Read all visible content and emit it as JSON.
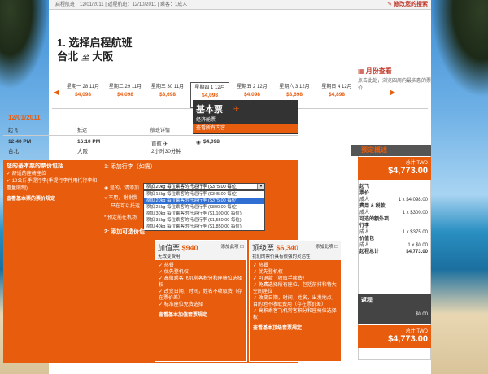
{
  "top_bar": {
    "summary": "启程航班：12/01/2011 | 返程航班：12/10/2011 | 乘客：1成人",
    "modify_link": "✎ 修改您的搜索"
  },
  "step": {
    "title": "1. 选择启程航班",
    "origin": "台北",
    "to": "至",
    "destination": "大阪"
  },
  "month_view": {
    "title": "月份查看",
    "desc": "点击此处，浏览四周内最实惠的票价"
  },
  "dates": [
    {
      "label": "星期一 28 11月",
      "price": "$4,098"
    },
    {
      "label": "星期二 29 11月",
      "price": "$4,098"
    },
    {
      "label": "星期三 30 11月",
      "price": "$3,698"
    },
    {
      "label": "星期四 1 12月",
      "price": "$4,098"
    },
    {
      "label": "星期五 2 12月",
      "price": "$4,098"
    },
    {
      "label": "星期六 3 12月",
      "price": "$3,698"
    },
    {
      "label": "星期日 4 12月",
      "price": "$4,898"
    }
  ],
  "fare_header": {
    "title": "基本票",
    "subtitle": "经济舱票",
    "sub_bar": "查看所有内容"
  },
  "table": {
    "date": "12/01/2011",
    "columns": [
      "起飞",
      "抵达",
      "航班详情"
    ],
    "flight": {
      "dep_time": "12:40 PM",
      "dep_city": "台北",
      "arr_time": "16:10 PM",
      "arr_city": "大阪",
      "details": "直航 ✈",
      "duration": "2小时30分钟",
      "price": "$4,098"
    }
  },
  "basic_includes": {
    "title": "您的基本票的票价包括",
    "items": [
      "舒适的座椅座位",
      "10公斤手提行李(手提行李件用托行李和重量限制)"
    ],
    "link": "查看基本票的票价规定"
  },
  "baggage": {
    "title": "1: 添加行李（如需）",
    "yes_label": "是的，请添加",
    "no_label": "不用，谢谢我",
    "no_sub": "只在可以托运",
    "note": "* 预定前在机场",
    "selected": "添加 20kg 每位乘客的托运行李 ($375.00 每位)",
    "options": [
      "添加 15kg 每位乘客的托运行李 ($345.00 每位)",
      "添加 20kg 每位乘客的托运行李 ($375.00 每位)",
      "添加 25kg 每位乘客的托运行李 ($800.00 每位)",
      "添加 30kg 每位乘客的托运行李 ($1,100.00 每位)",
      "添加 35kg 每位乘客的托运行李 ($1,550.00 每位)",
      "添加 40kg 每位乘客的托运行李 ($1,850.00 每位)"
    ]
  },
  "section2": "2: 添加可选价包",
  "package_value": {
    "name": "加值票",
    "price": "$940",
    "sub": "无改变费用",
    "add": "添加此项",
    "items": [
      "热餐",
      "优先登机权",
      "高敬乘客飞机常客积分和座椅位选择权",
      "改变日期，时间，姓名不收取费（存在票价差）",
      "标准座位免费选择"
    ],
    "link": "查看基本加值套票规定"
  },
  "package_top": {
    "name": "顶级票",
    "price": "$6,340",
    "sub": "我们的票价具有很强的灵活性",
    "add": "添加此项",
    "items": [
      "热餐",
      "优先登机权",
      "可退款（收取手续费）",
      "免费选择所有座位，包括前排和特大空间座位",
      "改变日期，时间，姓名，出发地点，目的地不收取费用（存在票价差）",
      "高积乘客飞机常客积分和座椅位选择权"
    ],
    "link": "查看基本顶级套票规定"
  },
  "summary": {
    "title": "预定概述",
    "total_label": "总计 TWD",
    "total": "$4,773.00",
    "dep_title": "起飞",
    "rows": [
      {
        "label": "票价",
        "value": ""
      },
      {
        "label": "成人",
        "value": "1 x $4,098.00"
      },
      {
        "label": "费用 & 税款",
        "value": ""
      },
      {
        "label": "成人",
        "value": "1 x $300.00"
      },
      {
        "label": "可选的额外项",
        "value": ""
      },
      {
        "label": "行李",
        "value": ""
      },
      {
        "label": "成人",
        "value": "1 x $375.00"
      },
      {
        "label": "价值包",
        "value": ""
      },
      {
        "label": "成人",
        "value": "1 x $0.00"
      },
      {
        "label": "起程总计",
        "value": "$4,773.00"
      }
    ],
    "return_title": "返程",
    "return_value": "$0.00",
    "final_label": "总计 TWD",
    "final_total": "$4,773.00"
  },
  "colors": {
    "orange": "#e85c0d",
    "dark": "#333333"
  }
}
